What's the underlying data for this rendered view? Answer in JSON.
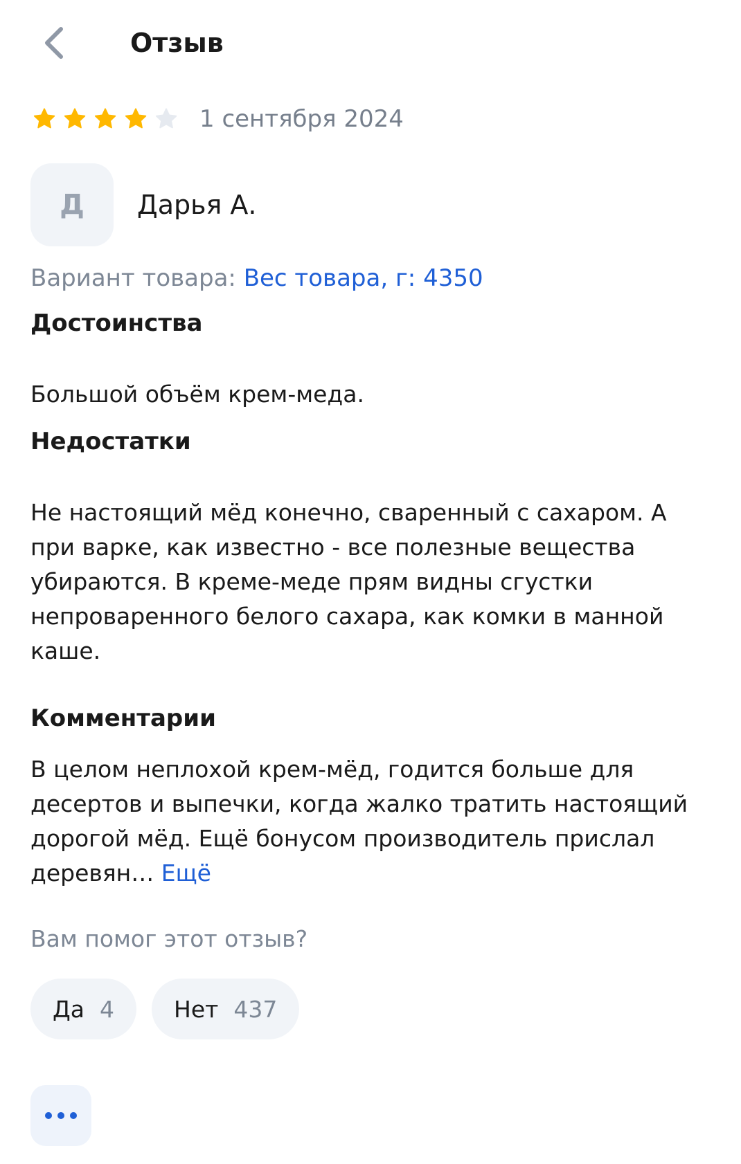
{
  "header": {
    "title": "Отзыв",
    "back_icon": "chevron-left-icon"
  },
  "review": {
    "rating": 4,
    "rating_max": 5,
    "star_color_filled": "#FFB800",
    "star_color_empty": "#E6EAF0",
    "date": "1 сентября 2024",
    "author": {
      "initial": "Д",
      "name": "Дарья А."
    },
    "variant": {
      "label": "Вариант товара: ",
      "value": "Вес товара, г: 4350"
    },
    "pros": {
      "title": "Достоинства",
      "text": "Большой объём крем-меда."
    },
    "cons": {
      "title": "Недостатки",
      "text": "Не настоящий мёд конечно, сваренный с сахаром. А при варке, как известно - все полезные вещества убираются. В креме-меде прям видны сгустки непроваренного белого сахара, как комки в манной каше."
    },
    "comments": {
      "title": "Комментарии",
      "text": "В целом неплохой крем-мёд, годится больше для десертов и выпечки, когда жалко тратить настоящий дорогой мёд. Ещё бонусом производитель прислал деревян…",
      "more_label": "Ещё"
    }
  },
  "helpful": {
    "question": "Вам помог этот отзыв?",
    "yes_label": "Да",
    "yes_count": "4",
    "no_label": "Нет",
    "no_count": "437"
  },
  "actions": {
    "more_icon": "more-dots-icon"
  },
  "colors": {
    "accent": "#1F5FD6",
    "muted_text": "#7D8795",
    "chip_bg": "#F1F4F8"
  }
}
